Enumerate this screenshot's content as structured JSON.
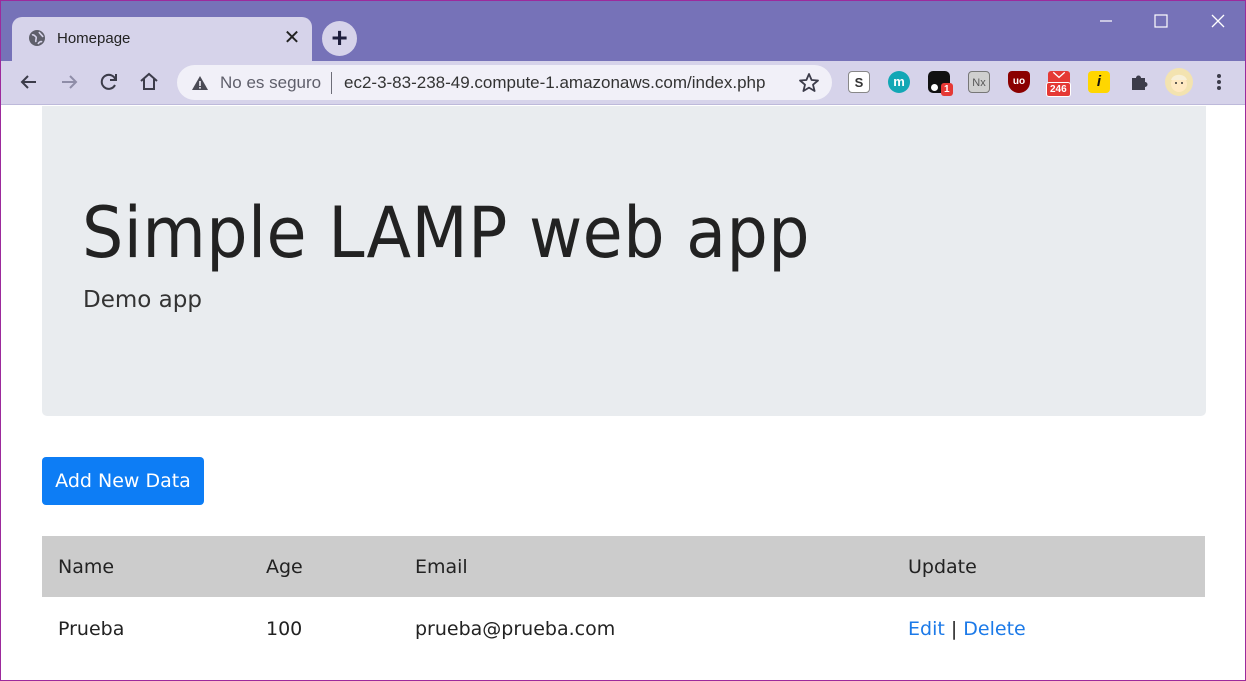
{
  "browser": {
    "tab_title": "Homepage",
    "tab_close": "✕",
    "new_tab": "+",
    "omnibox": {
      "security_label": "No es seguro",
      "url": "ec2-3-83-238-49.compute-1.amazonaws.com/index.php"
    },
    "extensions": [
      {
        "name": "s-extension",
        "label": "S"
      },
      {
        "name": "m-extension",
        "label": "m"
      },
      {
        "name": "notification-extension",
        "label": "",
        "badge": "1"
      },
      {
        "name": "nx-extension",
        "label": "Nx"
      },
      {
        "name": "ublock-extension",
        "label": "uo"
      },
      {
        "name": "mail-extension",
        "label": "",
        "badge": "246"
      },
      {
        "name": "i-extension",
        "label": "i"
      }
    ],
    "colors": {
      "frame": "#7672b8",
      "toolbar": "#d6d3ea",
      "accent": "#9c2a9c"
    }
  },
  "page": {
    "jumbotron": {
      "title": "Simple LAMP web app",
      "subtitle": "Demo app"
    },
    "add_button": "Add New Data",
    "table": {
      "headers": [
        "Name",
        "Age",
        "Email",
        "Update"
      ],
      "rows": [
        {
          "name": "Prueba",
          "age": "100",
          "email": "prueba@prueba.com",
          "edit": "Edit",
          "separator": "|",
          "delete": "Delete"
        }
      ]
    },
    "colors": {
      "button": "#0d7df5",
      "link": "#1c7ae8",
      "jumbotron_bg": "#e9ecef",
      "table_header_bg": "#cccccc"
    }
  }
}
